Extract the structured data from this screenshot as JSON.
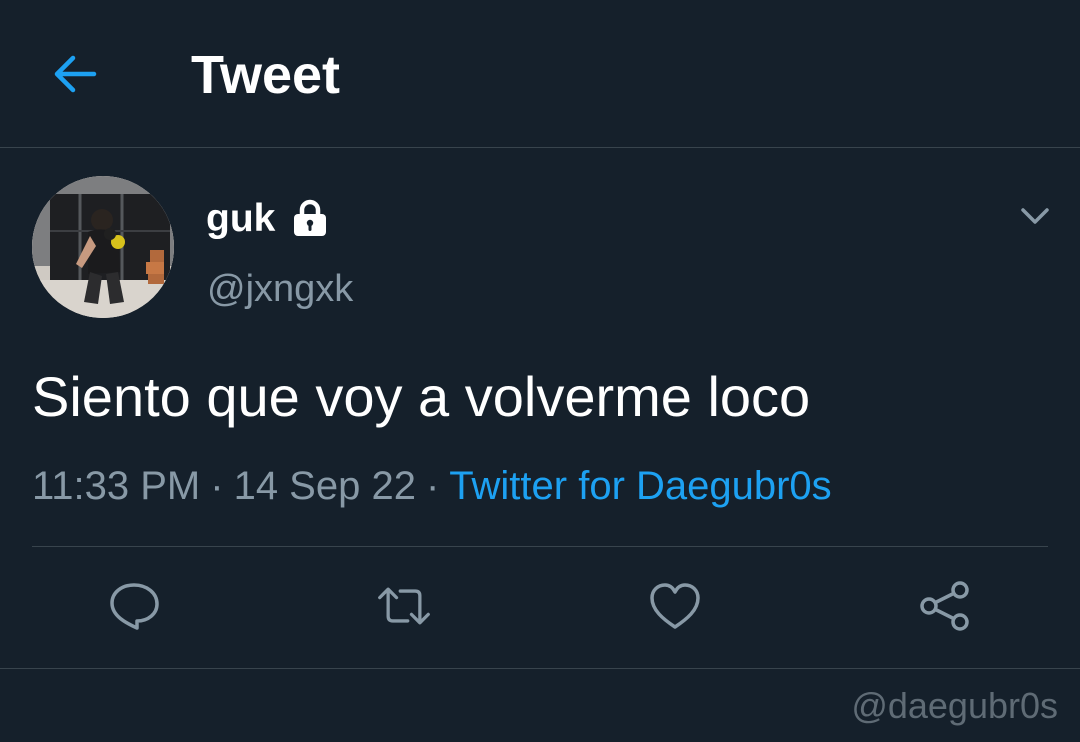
{
  "header": {
    "back_icon": "arrow-left-icon",
    "title": "Tweet"
  },
  "author": {
    "display_name": "guk",
    "protected_icon": "lock-icon",
    "handle": "@jxngxk"
  },
  "tweet": {
    "text": "Siento que voy a volverme loco",
    "time": "11:33 PM",
    "date": "14 Sep 22",
    "separator": "·",
    "source": "Twitter for Daegubr0s"
  },
  "actions": {
    "reply_icon": "reply-icon",
    "retweet_icon": "retweet-icon",
    "like_icon": "heart-icon",
    "share_icon": "share-icon"
  },
  "watermark": "@daegubr0s",
  "colors": {
    "background": "#15202b",
    "accent": "#1da1f2",
    "secondary_text": "#8899a6",
    "divider": "#38444d"
  }
}
